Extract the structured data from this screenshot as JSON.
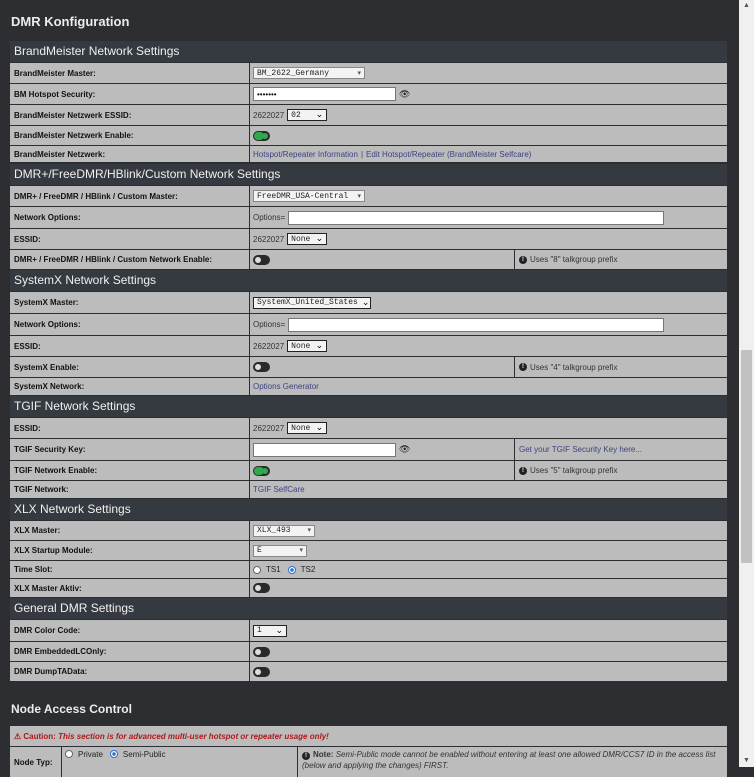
{
  "page_title": "DMR Konfiguration",
  "sections": {
    "brandmeister": {
      "title": "BrandMeister Network Settings",
      "master_label": "BrandMeister Master:",
      "master_value": "BM_2622_Germany",
      "security_label": "BM Hotspot Security:",
      "security_value": "•••••••",
      "essid_label": "BrandMeister Netzwerk ESSID:",
      "essid_prefix": "2622027",
      "essid_value": "02",
      "enable_label": "BrandMeister Netzwerk Enable:",
      "enable_state": "on",
      "network_label": "BrandMeister Netzwerk:",
      "link_info": "Hotspot/Repeater Information",
      "link_sep": "|",
      "link_edit": "Edit Hotspot/Repeater (BrandMeister Selfcare)"
    },
    "dmrplus": {
      "title": "DMR+/FreeDMR/HBlink/Custom Network Settings",
      "master_label": "DMR+ / FreeDMR / HBlink / Custom Master:",
      "master_value": "FreeDMR_USA-Central",
      "options_label": "Network Options:",
      "options_prefix": "Options=",
      "essid_label": "ESSID:",
      "essid_prefix": "2622027",
      "essid_value": "None",
      "enable_label": "DMR+ / FreeDMR / HBlink / Custom Network Enable:",
      "enable_state": "off",
      "note": "Uses \"8\" talkgroup prefix"
    },
    "systemx": {
      "title": "SystemX Network Settings",
      "master_label": "SystemX Master:",
      "master_value": "SystemX_United_States",
      "options_label": "Network Options:",
      "options_prefix": "Options=",
      "essid_label": "ESSID:",
      "essid_prefix": "2622027",
      "essid_value": "None",
      "enable_label": "SystemX Enable:",
      "enable_state": "off",
      "note": "Uses \"4\" talkgroup prefix",
      "network_label": "SystemX Network:",
      "network_link": "Options Generator"
    },
    "tgif": {
      "title": "TGIF Network Settings",
      "essid_label": "ESSID:",
      "essid_prefix": "2622027",
      "essid_value": "None",
      "key_label": "TGIF Security Key:",
      "key_link": "Get your TGIF Security Key here...",
      "enable_label": "TGIF Network Enable:",
      "enable_state": "on",
      "note": "Uses \"5\" talkgroup prefix",
      "network_label": "TGIF Network:",
      "network_link": "TGIF SelfCare"
    },
    "xlx": {
      "title": "XLX Network Settings",
      "master_label": "XLX Master:",
      "master_value": "XLX_493",
      "module_label": "XLX Startup Module:",
      "module_value": "E",
      "timeslot_label": "Time Slot:",
      "ts1": "TS1",
      "ts2": "TS2",
      "timeslot_selected": "TS2",
      "aktiv_label": "XLX Master Aktiv:",
      "aktiv_state": "off"
    },
    "general": {
      "title": "General DMR Settings",
      "color_label": "DMR Color Code:",
      "color_value": "1",
      "embedded_label": "DMR EmbeddedLCOnly:",
      "embedded_state": "off",
      "dump_label": "DMR DumpTAData:",
      "dump_state": "off"
    }
  },
  "node_access": {
    "title": "Node Access Control",
    "caution_strong": "Caution:",
    "caution_text": "This section is for advanced multi-user hotspot or repeater usage only!",
    "type_label": "Node Typ:",
    "private": "Private",
    "semi_public": "Semi-Public",
    "selected": "Semi-Public",
    "note_strong": "Note:",
    "note_text": "Semi-Public mode cannot be enabled without entering at least one allowed DMR/CCS7 ID in the access list (below and applying the changes) FIRST."
  },
  "colors": {
    "background": "#2c2e31",
    "section_header": "#343a40",
    "row": "#bcbcbc",
    "toggle_on": "#2fa84f",
    "link": "#3c4380",
    "caution": "#b01818"
  }
}
